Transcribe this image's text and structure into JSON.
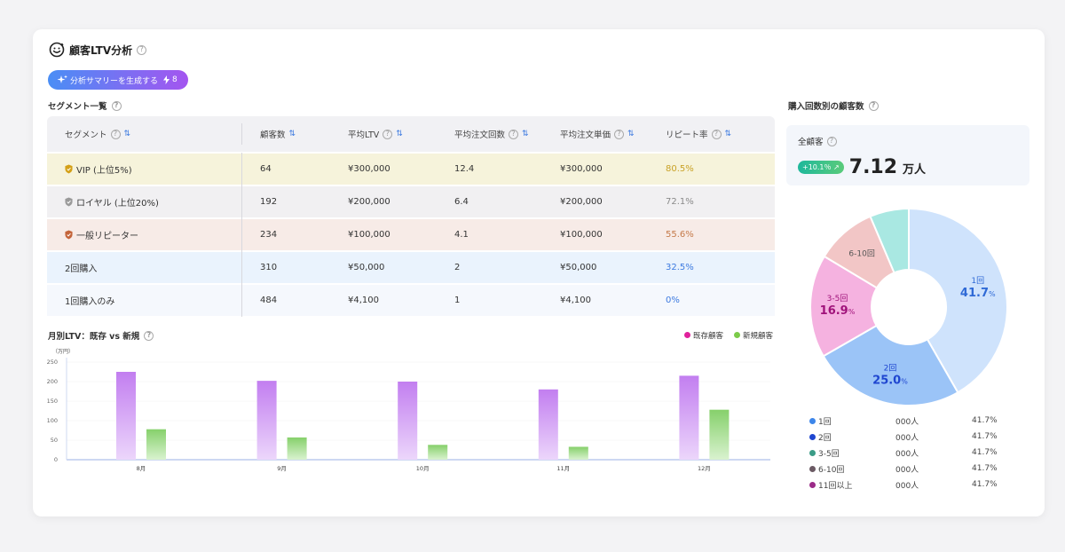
{
  "header": {
    "title": "顧客LTV分析",
    "help": "?"
  },
  "generate_button": {
    "label": "分析サマリーを生成する",
    "credit": "8"
  },
  "segment_section": {
    "title": "セグメント一覧"
  },
  "table": {
    "headers": [
      "セグメント",
      "顧客数",
      "平均LTV",
      "平均注文回数",
      "平均注文単価",
      "リピート率"
    ],
    "rows": [
      {
        "segment": "VIP (上位5%)",
        "customers": "64",
        "ltv": "¥300,000",
        "orders": "12.4",
        "aov": "¥300,000",
        "repeat": "80.5%",
        "bg": "#f6f3db",
        "repeat_color": "#c9a227",
        "badge_color": "#d4a017"
      },
      {
        "segment": "ロイヤル (上位20%)",
        "customers": "192",
        "ltv": "¥200,000",
        "orders": "6.4",
        "aov": "¥200,000",
        "repeat": "72.1%",
        "bg": "#f1f0f2",
        "repeat_color": "#8a8a8a",
        "badge_color": "#9a9a9a"
      },
      {
        "segment": "一般リピーター",
        "customers": "234",
        "ltv": "¥100,000",
        "orders": "4.1",
        "aov": "¥100,000",
        "repeat": "55.6%",
        "bg": "#f7ebe7",
        "repeat_color": "#c57a4a",
        "badge_color": "#c4643a"
      },
      {
        "segment": "2回購入",
        "customers": "310",
        "ltv": "¥50,000",
        "orders": "2",
        "aov": "¥50,000",
        "repeat": "32.5%",
        "bg": "#eaf3fd",
        "repeat_color": "#3e7be0",
        "badge_color": ""
      },
      {
        "segment": "1回購入のみ",
        "customers": "484",
        "ltv": "¥4,100",
        "orders": "1",
        "aov": "¥4,100",
        "repeat": "0%",
        "bg": "#f5f8fd",
        "repeat_color": "#3e7be0",
        "badge_color": ""
      }
    ]
  },
  "monthly_chart": {
    "title": "月別LTV：既存 vs 新規",
    "unit": "（万円）",
    "legend": [
      {
        "name": "既存顧客",
        "color": "#e0219c"
      },
      {
        "name": "新規顧客",
        "color": "#7ccb4a"
      }
    ]
  },
  "purchase_section": {
    "title": "購入回数別の顧客数"
  },
  "total": {
    "label": "全顧客",
    "change": "+10.1％",
    "value": "7.12",
    "unit": "万人"
  },
  "donut_labels": [
    {
      "label": "1回",
      "pct": "41.7",
      "pct_unit": "%"
    },
    {
      "label": "2回",
      "pct": "25.0",
      "pct_unit": "%"
    },
    {
      "label": "3-5回",
      "pct": "16.9",
      "pct_unit": "%"
    },
    {
      "label": "6-10回"
    }
  ],
  "legend_list": [
    {
      "label": "1回",
      "count": "000人",
      "pct": "41.7%",
      "color": "#3d86ea"
    },
    {
      "label": "2回",
      "count": "000人",
      "pct": "41.7%",
      "color": "#1f46d0"
    },
    {
      "label": "3-5回",
      "count": "000人",
      "pct": "41.7%",
      "color": "#3b9c87"
    },
    {
      "label": "6-10回",
      "count": "000人",
      "pct": "41.7%",
      "color": "#6b5a64"
    },
    {
      "label": "11回以上",
      "count": "000人",
      "pct": "41.7%",
      "color": "#9b2b88"
    }
  ],
  "chart_data": [
    {
      "type": "bar",
      "title": "月別LTV：既存 vs 新規",
      "ylabel": "（万円）",
      "categories": [
        "8月",
        "9月",
        "10月",
        "11月",
        "12月"
      ],
      "yticks": [
        "0",
        "50",
        "100",
        "150",
        "200",
        "250"
      ],
      "ylim": [
        0,
        250
      ],
      "series": [
        {
          "name": "既存顧客",
          "values": [
            225,
            202,
            200,
            180,
            215
          ],
          "color": "#c98af2"
        },
        {
          "name": "新規顧客",
          "values": [
            78,
            57,
            38,
            33,
            128
          ],
          "color": "#8fd37a"
        }
      ]
    },
    {
      "type": "pie",
      "title": "購入回数別の顧客数",
      "categories": [
        "1回",
        "2回",
        "3-5回",
        "6-10回",
        "11回以上"
      ],
      "values": [
        41.7,
        25.0,
        16.9,
        10.0,
        6.4
      ],
      "colors": [
        "#cfe3fc",
        "#9bc4f7",
        "#f5b2e0",
        "#f2c6c6",
        "#a9e8e2"
      ]
    }
  ]
}
